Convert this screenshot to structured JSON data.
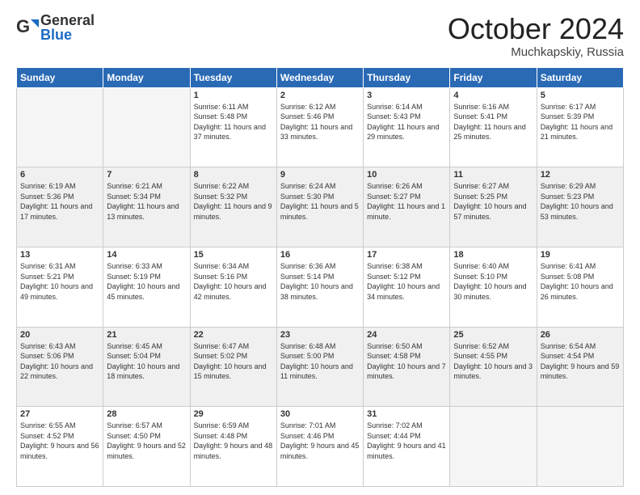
{
  "header": {
    "logo_general": "General",
    "logo_blue": "Blue",
    "month": "October 2024",
    "location": "Muchkapskiy, Russia"
  },
  "weekdays": [
    "Sunday",
    "Monday",
    "Tuesday",
    "Wednesday",
    "Thursday",
    "Friday",
    "Saturday"
  ],
  "weeks": [
    [
      {
        "day": "",
        "info": ""
      },
      {
        "day": "",
        "info": ""
      },
      {
        "day": "1",
        "info": "Sunrise: 6:11 AM\nSunset: 5:48 PM\nDaylight: 11 hours and 37 minutes."
      },
      {
        "day": "2",
        "info": "Sunrise: 6:12 AM\nSunset: 5:46 PM\nDaylight: 11 hours and 33 minutes."
      },
      {
        "day": "3",
        "info": "Sunrise: 6:14 AM\nSunset: 5:43 PM\nDaylight: 11 hours and 29 minutes."
      },
      {
        "day": "4",
        "info": "Sunrise: 6:16 AM\nSunset: 5:41 PM\nDaylight: 11 hours and 25 minutes."
      },
      {
        "day": "5",
        "info": "Sunrise: 6:17 AM\nSunset: 5:39 PM\nDaylight: 11 hours and 21 minutes."
      }
    ],
    [
      {
        "day": "6",
        "info": "Sunrise: 6:19 AM\nSunset: 5:36 PM\nDaylight: 11 hours and 17 minutes."
      },
      {
        "day": "7",
        "info": "Sunrise: 6:21 AM\nSunset: 5:34 PM\nDaylight: 11 hours and 13 minutes."
      },
      {
        "day": "8",
        "info": "Sunrise: 6:22 AM\nSunset: 5:32 PM\nDaylight: 11 hours and 9 minutes."
      },
      {
        "day": "9",
        "info": "Sunrise: 6:24 AM\nSunset: 5:30 PM\nDaylight: 11 hours and 5 minutes."
      },
      {
        "day": "10",
        "info": "Sunrise: 6:26 AM\nSunset: 5:27 PM\nDaylight: 11 hours and 1 minute."
      },
      {
        "day": "11",
        "info": "Sunrise: 6:27 AM\nSunset: 5:25 PM\nDaylight: 10 hours and 57 minutes."
      },
      {
        "day": "12",
        "info": "Sunrise: 6:29 AM\nSunset: 5:23 PM\nDaylight: 10 hours and 53 minutes."
      }
    ],
    [
      {
        "day": "13",
        "info": "Sunrise: 6:31 AM\nSunset: 5:21 PM\nDaylight: 10 hours and 49 minutes."
      },
      {
        "day": "14",
        "info": "Sunrise: 6:33 AM\nSunset: 5:19 PM\nDaylight: 10 hours and 45 minutes."
      },
      {
        "day": "15",
        "info": "Sunrise: 6:34 AM\nSunset: 5:16 PM\nDaylight: 10 hours and 42 minutes."
      },
      {
        "day": "16",
        "info": "Sunrise: 6:36 AM\nSunset: 5:14 PM\nDaylight: 10 hours and 38 minutes."
      },
      {
        "day": "17",
        "info": "Sunrise: 6:38 AM\nSunset: 5:12 PM\nDaylight: 10 hours and 34 minutes."
      },
      {
        "day": "18",
        "info": "Sunrise: 6:40 AM\nSunset: 5:10 PM\nDaylight: 10 hours and 30 minutes."
      },
      {
        "day": "19",
        "info": "Sunrise: 6:41 AM\nSunset: 5:08 PM\nDaylight: 10 hours and 26 minutes."
      }
    ],
    [
      {
        "day": "20",
        "info": "Sunrise: 6:43 AM\nSunset: 5:06 PM\nDaylight: 10 hours and 22 minutes."
      },
      {
        "day": "21",
        "info": "Sunrise: 6:45 AM\nSunset: 5:04 PM\nDaylight: 10 hours and 18 minutes."
      },
      {
        "day": "22",
        "info": "Sunrise: 6:47 AM\nSunset: 5:02 PM\nDaylight: 10 hours and 15 minutes."
      },
      {
        "day": "23",
        "info": "Sunrise: 6:48 AM\nSunset: 5:00 PM\nDaylight: 10 hours and 11 minutes."
      },
      {
        "day": "24",
        "info": "Sunrise: 6:50 AM\nSunset: 4:58 PM\nDaylight: 10 hours and 7 minutes."
      },
      {
        "day": "25",
        "info": "Sunrise: 6:52 AM\nSunset: 4:55 PM\nDaylight: 10 hours and 3 minutes."
      },
      {
        "day": "26",
        "info": "Sunrise: 6:54 AM\nSunset: 4:54 PM\nDaylight: 9 hours and 59 minutes."
      }
    ],
    [
      {
        "day": "27",
        "info": "Sunrise: 6:55 AM\nSunset: 4:52 PM\nDaylight: 9 hours and 56 minutes."
      },
      {
        "day": "28",
        "info": "Sunrise: 6:57 AM\nSunset: 4:50 PM\nDaylight: 9 hours and 52 minutes."
      },
      {
        "day": "29",
        "info": "Sunrise: 6:59 AM\nSunset: 4:48 PM\nDaylight: 9 hours and 48 minutes."
      },
      {
        "day": "30",
        "info": "Sunrise: 7:01 AM\nSunset: 4:46 PM\nDaylight: 9 hours and 45 minutes."
      },
      {
        "day": "31",
        "info": "Sunrise: 7:02 AM\nSunset: 4:44 PM\nDaylight: 9 hours and 41 minutes."
      },
      {
        "day": "",
        "info": ""
      },
      {
        "day": "",
        "info": ""
      }
    ]
  ]
}
